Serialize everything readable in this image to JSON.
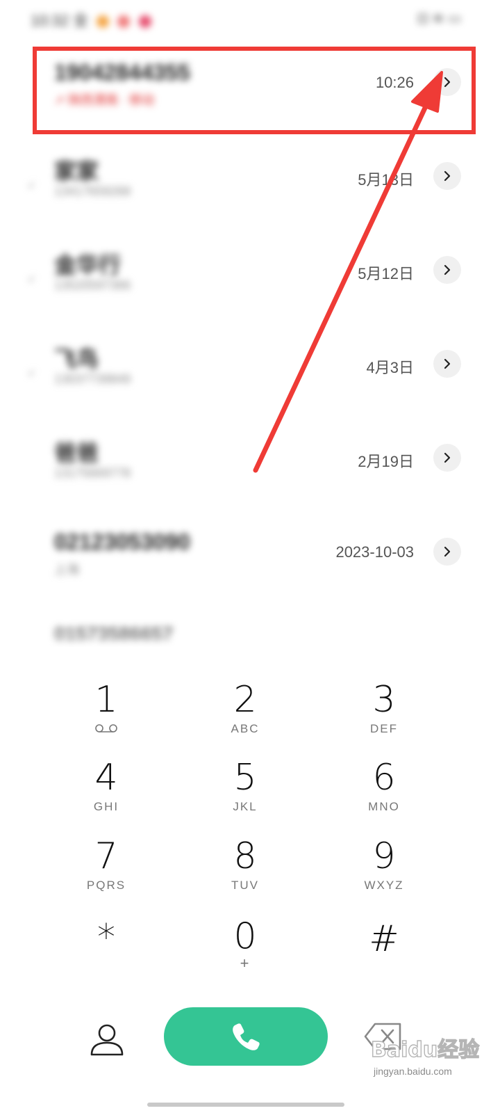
{
  "status_bar": {
    "time": "10:32 全",
    "right": "⊡ ≋ ▭"
  },
  "call_log": [
    {
      "name": "19042844355",
      "sub": "↗ 陕西渭南 · 移动",
      "time": "10:26",
      "highlighted": true
    },
    {
      "name": "家家",
      "sub": "13417659268",
      "time": "5月13日"
    },
    {
      "name": "金华行",
      "sub": "13520597366",
      "time": "5月12日"
    },
    {
      "name": "飞鸟",
      "sub": "13037739849",
      "time": "4月3日"
    },
    {
      "name": "爸爸",
      "sub": "13175669778",
      "time": "2月19日"
    },
    {
      "name": "02123053090",
      "sub": "上海",
      "time": "2023-10-03"
    },
    {
      "name": "01573586657",
      "sub": "",
      "time": ""
    }
  ],
  "dialpad": {
    "keys": [
      {
        "digit": "1",
        "letters": "",
        "icon": "voicemail-icon"
      },
      {
        "digit": "2",
        "letters": "ABC"
      },
      {
        "digit": "3",
        "letters": "DEF"
      },
      {
        "digit": "4",
        "letters": "GHI"
      },
      {
        "digit": "5",
        "letters": "JKL"
      },
      {
        "digit": "6",
        "letters": "MNO"
      },
      {
        "digit": "7",
        "letters": "PQRS"
      },
      {
        "digit": "8",
        "letters": "TUV"
      },
      {
        "digit": "9",
        "letters": "WXYZ"
      },
      {
        "digit": "*",
        "letters": ""
      },
      {
        "digit": "0",
        "letters": "+"
      },
      {
        "digit": "#",
        "letters": ""
      }
    ]
  },
  "bottom_bar": {
    "contacts_icon": "person-icon",
    "call_icon": "phone-icon",
    "backspace_icon": "backspace-icon"
  },
  "colors": {
    "accent_green": "#34c594",
    "annotation_red": "#ef3b36"
  },
  "watermark": {
    "text": "Baidu经验",
    "sub": "jingyan.baidu.com"
  }
}
